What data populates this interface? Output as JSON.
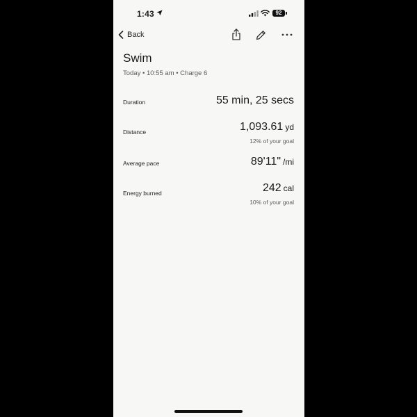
{
  "status_bar": {
    "time": "1:43",
    "battery": "92",
    "icons": [
      "location-arrow-icon",
      "cellular-signal-icon",
      "wifi-icon",
      "battery-icon"
    ]
  },
  "nav": {
    "back_label": "Back",
    "icons": [
      "chevron-left-icon",
      "share-icon",
      "pencil-icon",
      "more-icon"
    ]
  },
  "workout": {
    "title": "Swim",
    "subtitle": "Today • 10:55 am • Charge 6"
  },
  "metrics": {
    "duration": {
      "label": "Duration",
      "value": "55 min, 25 secs"
    },
    "distance": {
      "label": "Distance",
      "number": "1,093.61",
      "unit": "yd",
      "goal": "12% of your goal"
    },
    "pace": {
      "label": "Average pace",
      "number": "89'11\"",
      "unit": "/mi"
    },
    "energy": {
      "label": "Energy burned",
      "number": "242",
      "unit": "cal",
      "goal": "10% of your goal"
    }
  }
}
